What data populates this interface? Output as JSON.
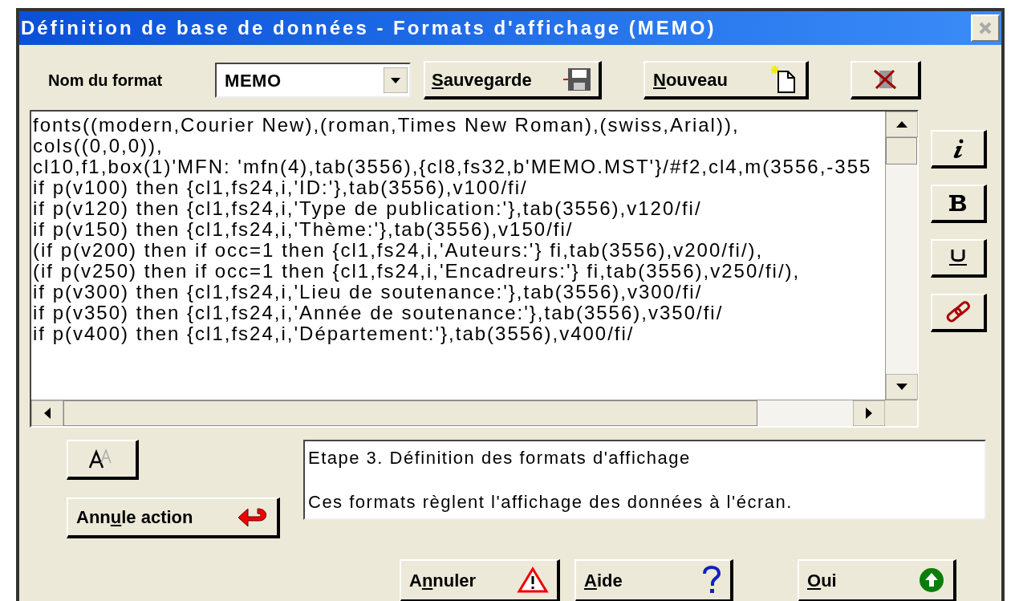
{
  "window": {
    "title": "Définition de base de données - Formats d'affichage (MEMO)"
  },
  "format_name": {
    "label": "Nom du format",
    "value": "MEMO"
  },
  "top_buttons": [
    {
      "kind": "save",
      "key": "S",
      "post": "auvegarde"
    },
    {
      "kind": "new",
      "key": "N",
      "post": "ouveau"
    },
    {
      "kind": "delete"
    }
  ],
  "editor_lines": [
    "fonts((modern,Courier New),(roman,Times New Roman),(swiss,Arial)),",
    "cols((0,0,0)),",
    "cl10,f1,box(1)'MFN: 'mfn(4),tab(3556),{cl8,fs32,b'MEMO.MST'}/#f2,cl4,m(3556,-355",
    "if p(v100) then {cl1,fs24,i,'ID:'},tab(3556),v100/fi/",
    "if p(v120) then {cl1,fs24,i,'Type de publication:'},tab(3556),v120/fi/",
    "if p(v150) then {cl1,fs24,i,'Thème:'},tab(3556),v150/fi/",
    "(if p(v200) then if occ=1 then {cl1,fs24,i,'Auteurs:'} fi,tab(3556),v200/fi/),",
    "(if p(v250) then if occ=1 then {cl1,fs24,i,'Encadreurs:'} fi,tab(3556),v250/fi/),",
    "if p(v300) then {cl1,fs24,i,'Lieu de soutenance:'},tab(3556),v300/fi/",
    "if p(v350) then {cl1,fs24,i,'Année de soutenance:'},tab(3556),v350/fi/",
    "if p(v400) then {cl1,fs24,i,'Département:'},tab(3556),v400/fi/"
  ],
  "style_buttons": [
    {
      "kind": "italic"
    },
    {
      "kind": "bold"
    },
    {
      "kind": "underline"
    },
    {
      "kind": "link"
    }
  ],
  "undo_button": {
    "pre": "Ann",
    "key": "u",
    "post": "le action"
  },
  "info": {
    "title": "Etape 3. Définition des formats d'affichage",
    "text": "Ces formats règlent l'affichage des données à l'écran."
  },
  "bottom_buttons": [
    {
      "kind": "cancel",
      "pre": "A",
      "key": "n",
      "post": "nuler"
    },
    {
      "kind": "help",
      "key": "A",
      "post": "ide"
    },
    {
      "kind": "ok",
      "key": "O",
      "post": "ui"
    }
  ]
}
